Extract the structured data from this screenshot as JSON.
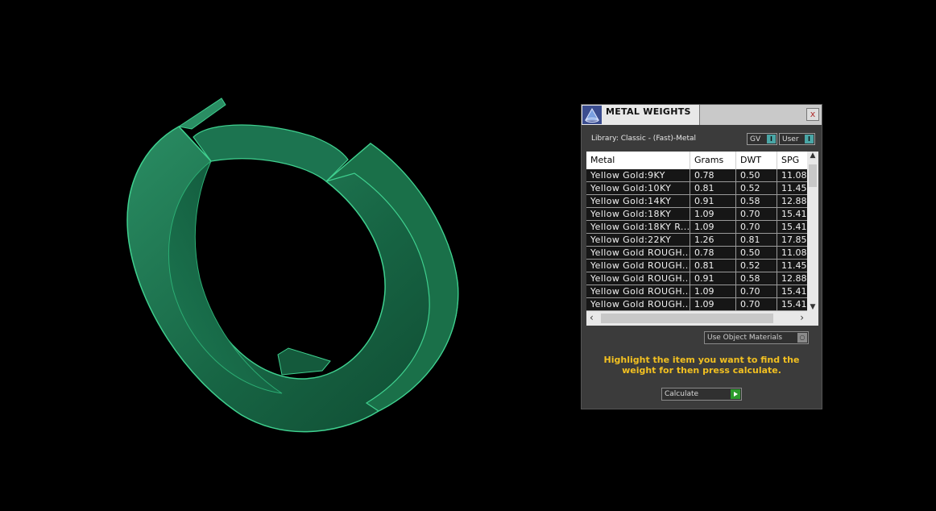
{
  "panel": {
    "title": "METAL WEIGHTS",
    "close_label": "x",
    "library_label": "Library: Classic - (Fast)-Metal",
    "toggles": [
      {
        "label": "GV",
        "knob": "I"
      },
      {
        "label": "User",
        "knob": "I"
      }
    ],
    "table": {
      "columns": [
        "Metal",
        "Grams",
        "DWT",
        "SPG"
      ],
      "rows": [
        [
          "Yellow Gold:9KY",
          "0.78",
          "0.50",
          "11.08"
        ],
        [
          "Yellow Gold:10KY",
          "0.81",
          "0.52",
          "11.45"
        ],
        [
          "Yellow Gold:14KY",
          "0.91",
          "0.58",
          "12.88"
        ],
        [
          "Yellow Gold:18KY",
          "1.09",
          "0.70",
          "15.41"
        ],
        [
          "Yellow Gold:18KY R...",
          "1.09",
          "0.70",
          "15.41"
        ],
        [
          "Yellow Gold:22KY",
          "1.26",
          "0.81",
          "17.85"
        ],
        [
          "Yellow Gold ROUGH...",
          "0.78",
          "0.50",
          "11.08"
        ],
        [
          "Yellow Gold ROUGH...",
          "0.81",
          "0.52",
          "11.45"
        ],
        [
          "Yellow Gold ROUGH...",
          "0.91",
          "0.58",
          "12.88"
        ],
        [
          "Yellow Gold ROUGH...",
          "1.09",
          "0.70",
          "15.41"
        ],
        [
          "Yellow Gold ROUGH...",
          "1.09",
          "0.70",
          "15.41"
        ]
      ]
    },
    "material_select": "Use Object Materials",
    "instruction": "Highlight the item you want to find the weight for then press calculate.",
    "calculate_label": "Calculate"
  },
  "colors": {
    "background": "#000000",
    "model_green": "#1f7a55",
    "model_edge": "#3fd08f",
    "instruction_text": "#f2c021",
    "accent_teal": "#4aa7a7"
  }
}
